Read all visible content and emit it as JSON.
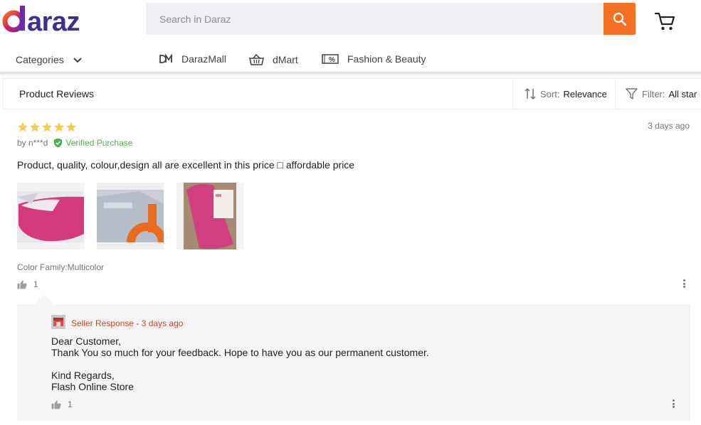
{
  "brand": {
    "logo_text": "daraz",
    "accent": "#f57224"
  },
  "search": {
    "placeholder": "Search in Daraz",
    "icon": "search-icon"
  },
  "cart": {
    "icon": "cart-icon"
  },
  "nav": {
    "categories_label": "Categories",
    "links": [
      {
        "label": "DarazMall",
        "icon": "darazmall-icon"
      },
      {
        "label": "dMart",
        "icon": "basket-icon"
      },
      {
        "label": "Fashion & Beauty",
        "icon": "percent-tag-icon"
      }
    ]
  },
  "reviews_bar": {
    "title": "Product Reviews",
    "sort_label": "Sort:",
    "sort_value": "Relevance",
    "filter_label": "Filter:",
    "filter_value": "All star"
  },
  "review": {
    "rating": 5,
    "star_color": "#faca51",
    "date": "3 days ago",
    "author": "by n***d",
    "verified": "Verified Purchase",
    "text": "Product, quality, colour,design all are excellent in this price □ affordable price",
    "photos": [
      "pink pouch on white package",
      "grey package with orange logo",
      "pink pouch with label"
    ],
    "sku": "Color Family:Multicolor",
    "likes": "1"
  },
  "seller_response": {
    "header": "Seller Response - 3 days ago",
    "lines": [
      "Dear Customer,",
      "Thank You so much for your feedback. Hope to have you as our permanent customer.",
      "",
      "Kind Regards,",
      "Flash Online Store"
    ],
    "likes": "1"
  }
}
